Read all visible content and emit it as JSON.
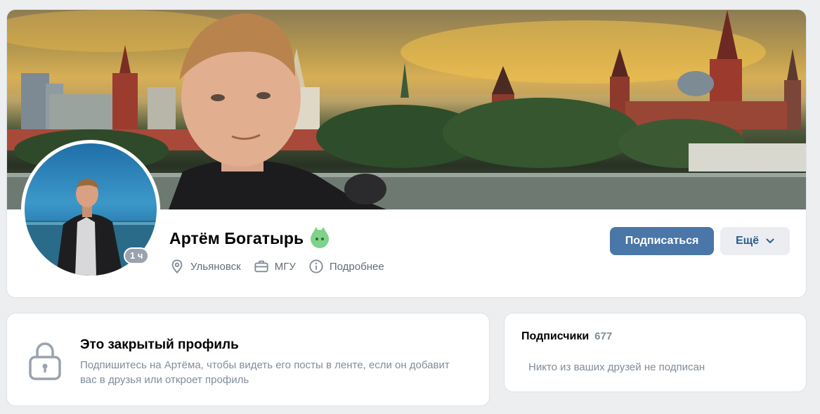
{
  "profile": {
    "name": "Артём Богатырь",
    "emoji_status_icon": "green-cat-icon",
    "online_badge": "1 ч",
    "info": [
      {
        "icon": "location-pin-icon",
        "label": "Ульяновск"
      },
      {
        "icon": "briefcase-icon",
        "label": "МГУ"
      },
      {
        "icon": "info-icon",
        "label": "Подробнее"
      }
    ],
    "subscribe_label": "Подписаться",
    "more_label": "Ещё"
  },
  "closed_profile": {
    "icon": "lock-icon",
    "title": "Это закрытый профиль",
    "text": "Подпишитесь на Артёма, чтобы видеть его посты в ленте, если он добавит вас в друзья или откроет профиль"
  },
  "followers": {
    "title": "Подписчики",
    "count": "677",
    "empty_text": "Никто из ваших друзей не подписан"
  },
  "colors": {
    "page_bg": "#edeef0",
    "primary_button": "#4a76a8",
    "secondary_button": "#ebedf0",
    "secondary_text": "#818c99",
    "link_text": "#2c5d8f"
  }
}
